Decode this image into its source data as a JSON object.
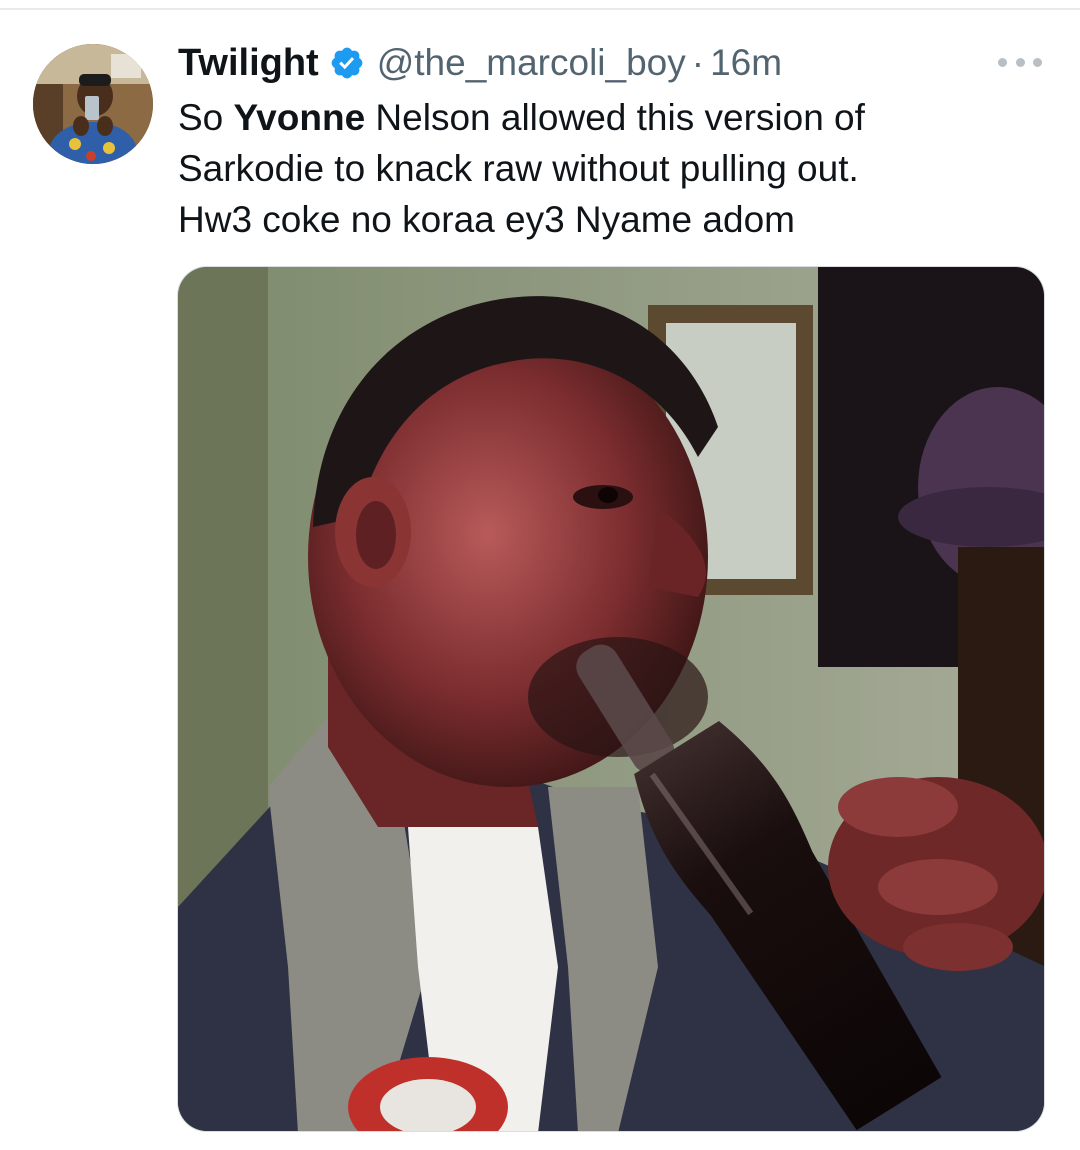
{
  "tweet": {
    "author": {
      "display_name": "Twilight",
      "verified": true,
      "handle": "@the_marcoli_boy",
      "separator": "·",
      "time": "16m"
    },
    "text_lines": [
      {
        "pre": "So ",
        "bold": "Yvonne",
        "post": " Nelson allowed this version of"
      },
      {
        "pre": "Sarkodie to knack raw without pulling out.",
        "bold": "",
        "post": ""
      },
      {
        "pre": "Hw3 coke no koraa ey3 Nyame adom",
        "bold": "",
        "post": ""
      }
    ],
    "media": {
      "kind": "photo",
      "subject": "man drinking from a bottle"
    }
  },
  "icons": {
    "verified": "verified-badge-icon",
    "more": "more-options-icon"
  },
  "colors": {
    "verified_blue": "#1d9bf0",
    "secondary_text": "#536471",
    "primary_text": "#0f1419"
  }
}
